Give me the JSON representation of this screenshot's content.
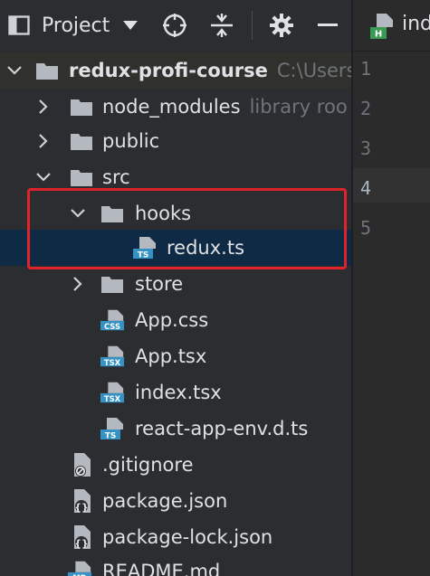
{
  "toolbar": {
    "title": "Project",
    "icons": [
      "project-window-icon",
      "chevron-down-icon",
      "locate-crosshair-icon",
      "collapse-all-icon",
      "gear-icon",
      "minimize-icon"
    ]
  },
  "tree": {
    "root": {
      "name": "redux-profi-course",
      "path": "C:\\Users\\"
    },
    "node_modules": {
      "name": "node_modules",
      "hint": "library roo"
    },
    "public": "public",
    "src": "src",
    "hooks": "hooks",
    "redux_ts": "redux.ts",
    "store": "store",
    "app_css": "App.css",
    "app_tsx": "App.tsx",
    "index_tsx": "index.tsx",
    "react_app_env": "react-app-env.d.ts",
    "gitignore": ".gitignore",
    "package_json": "package.json",
    "package_lock": "package-lock.json",
    "readme": "README.md"
  },
  "file_badges": {
    "ts": "TS",
    "css": "CSS",
    "tsx": "TSX",
    "md": "MD"
  },
  "editor": {
    "tab_label": "ind",
    "tab_badge": "H",
    "line_numbers": [
      "1",
      "2",
      "3",
      "4",
      "5"
    ],
    "current_line": "4"
  },
  "colors": {
    "panel_bg": "#2b2d30",
    "selection_bg": "#0e2a44",
    "folder_icon": "#b4b8bf",
    "ts_badge": "#3592c4",
    "highlight_box": "#e0232b"
  }
}
